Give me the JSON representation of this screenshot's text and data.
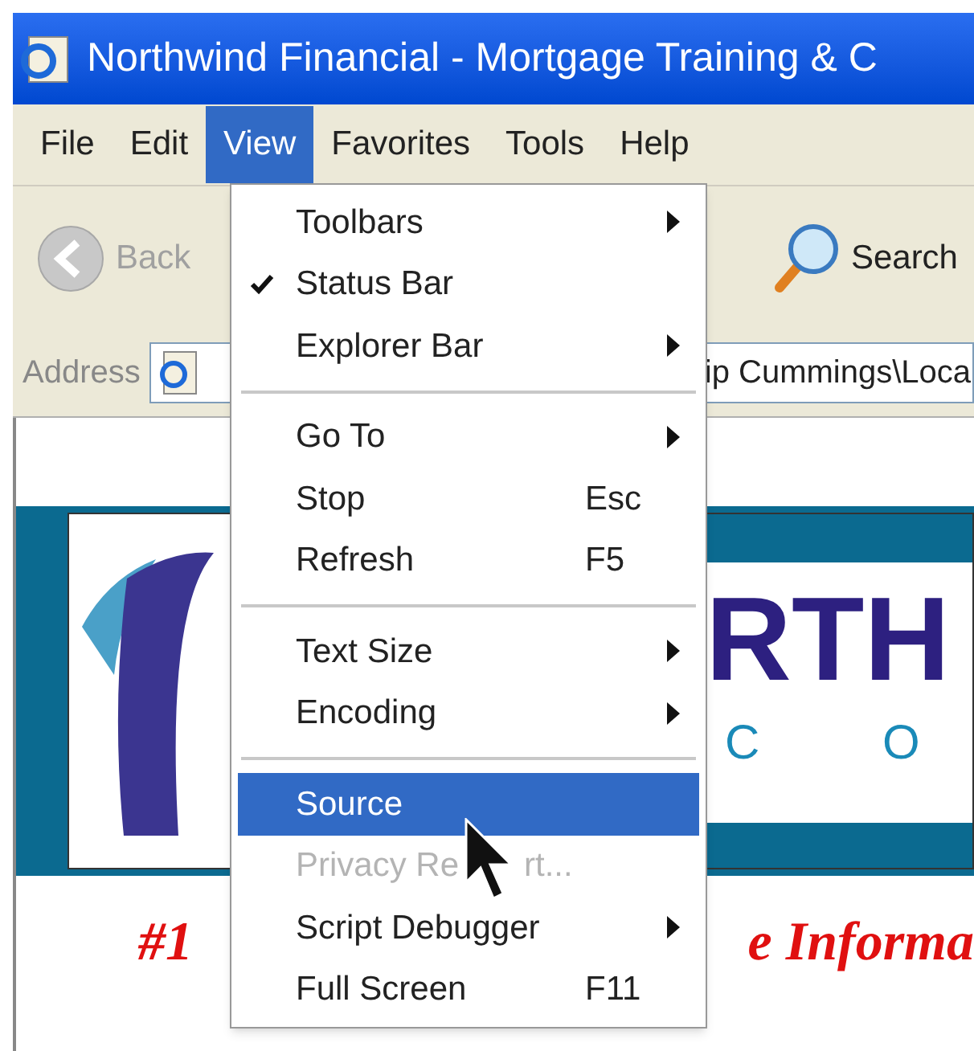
{
  "window": {
    "title": "Northwind Financial - Mortgage Training & C"
  },
  "menu_bar": [
    {
      "label": "File",
      "selected": false
    },
    {
      "label": "Edit",
      "selected": false
    },
    {
      "label": "View",
      "selected": true
    },
    {
      "label": "Favorites",
      "selected": false
    },
    {
      "label": "Tools",
      "selected": false
    },
    {
      "label": "Help",
      "selected": false
    }
  ],
  "toolbar": {
    "back": "Back",
    "search": "Search"
  },
  "address_bar": {
    "label": "Address",
    "value": "ip Cummings\\Loca"
  },
  "page": {
    "logo_text": "RTH",
    "logo_subtext": "C O",
    "tagline_start": "#1",
    "tagline_end": "e Informa"
  },
  "view_menu": [
    {
      "kind": "item",
      "label": "Toolbars",
      "submenu": true,
      "checked": false,
      "selected": false,
      "disabled": false
    },
    {
      "kind": "item",
      "label": "Status Bar",
      "submenu": false,
      "checked": true,
      "selected": false,
      "disabled": false
    },
    {
      "kind": "item",
      "label": "Explorer Bar",
      "submenu": true,
      "checked": false,
      "selected": false,
      "disabled": false
    },
    {
      "kind": "separator"
    },
    {
      "kind": "item",
      "label": "Go To",
      "submenu": true,
      "checked": false,
      "selected": false,
      "disabled": false
    },
    {
      "kind": "item",
      "label": "Stop",
      "shortcut": "Esc",
      "submenu": false,
      "checked": false,
      "selected": false,
      "disabled": false
    },
    {
      "kind": "item",
      "label": "Refresh",
      "shortcut": "F5",
      "submenu": false,
      "checked": false,
      "selected": false,
      "disabled": false
    },
    {
      "kind": "separator"
    },
    {
      "kind": "item",
      "label": "Text Size",
      "submenu": true,
      "checked": false,
      "selected": false,
      "disabled": false
    },
    {
      "kind": "item",
      "label": "Encoding",
      "submenu": true,
      "checked": false,
      "selected": false,
      "disabled": false
    },
    {
      "kind": "separator"
    },
    {
      "kind": "item",
      "label": "Source",
      "submenu": false,
      "checked": false,
      "selected": true,
      "disabled": false
    },
    {
      "kind": "item",
      "label": "Privacy Re",
      "label_after_pointer": "rt...",
      "submenu": false,
      "checked": false,
      "selected": false,
      "disabled": true
    },
    {
      "kind": "item",
      "label": "Script Debugger",
      "submenu": true,
      "checked": false,
      "selected": false,
      "disabled": false
    },
    {
      "kind": "item",
      "label": "Full Screen",
      "shortcut": "F11",
      "submenu": false,
      "checked": false,
      "selected": false,
      "disabled": false
    }
  ]
}
